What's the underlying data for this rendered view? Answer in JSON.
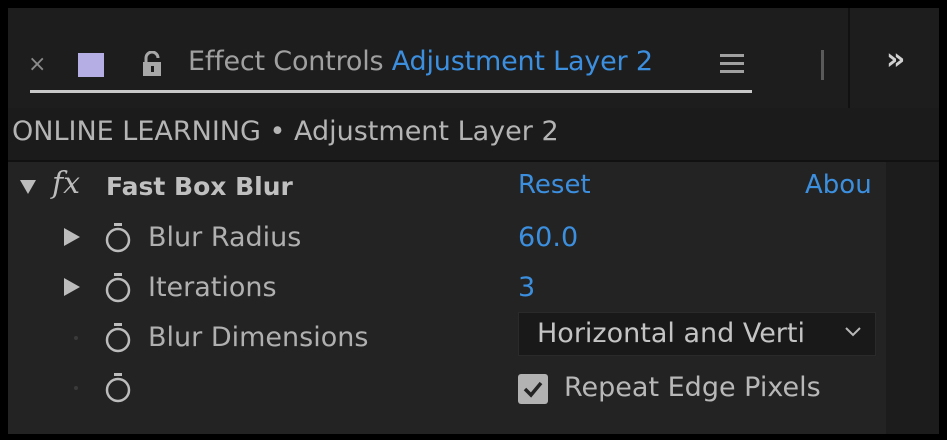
{
  "tab": {
    "close_glyph": "×",
    "swatch_color": "#b4aee4",
    "title": "Effect Controls",
    "layer": "Adjustment Layer 2",
    "more_glyph": "»",
    "icons": [
      "close-icon",
      "color-swatch-icon",
      "lock-icon",
      "panel-menu-icon",
      "chevron-double-right-icon"
    ]
  },
  "breadcrumb": "ONLINE LEARNING • Adjustment Layer 2",
  "effect": {
    "fx_glyph": "fx",
    "name": "Fast Box Blur",
    "reset": "Reset",
    "about": "Abou",
    "properties": [
      {
        "label": "Blur Radius",
        "value": "60.0"
      },
      {
        "label": "Iterations",
        "value": "3"
      },
      {
        "label": "Blur Dimensions",
        "value": "Horizontal and Verti"
      },
      {
        "label": "",
        "checkbox_label": "Repeat Edge Pixels",
        "checked": true
      }
    ]
  },
  "colors": {
    "accent": "#3c8fde",
    "panel": "#232323",
    "header": "#1d1d1d"
  }
}
